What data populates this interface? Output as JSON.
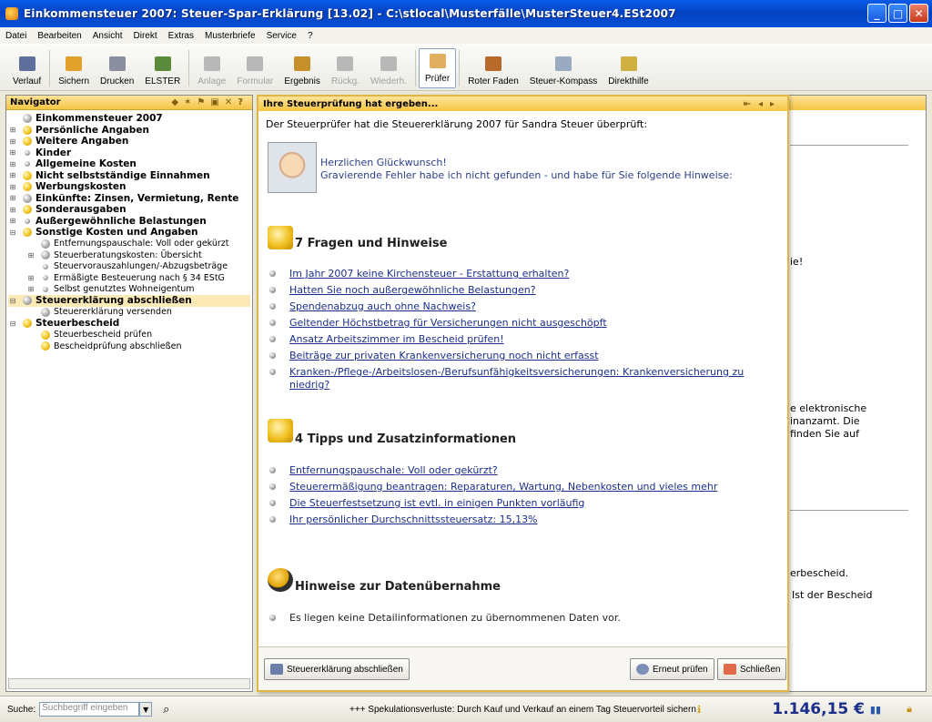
{
  "window": {
    "title": "Einkommensteuer 2007: Steuer-Spar-Erklärung [13.02] - C:\\stlocal\\Musterfälle\\MusterSteuer4.ESt2007"
  },
  "menu": [
    "Datei",
    "Bearbeiten",
    "Ansicht",
    "Direkt",
    "Extras",
    "Musterbriefe",
    "Service",
    "?"
  ],
  "toolbar": [
    {
      "label": "Verlauf",
      "state": "normal",
      "color": "#5d6f9a"
    },
    {
      "label": "Sichern",
      "state": "normal",
      "color": "#e2a12a"
    },
    {
      "label": "Drucken",
      "state": "normal",
      "color": "#8a8fa0"
    },
    {
      "label": "ELSTER",
      "state": "normal",
      "color": "#5a8a3a"
    },
    {
      "label": "Anlage",
      "state": "disabled",
      "color": "#b8b8b8"
    },
    {
      "label": "Formular",
      "state": "disabled",
      "color": "#b8b8b8"
    },
    {
      "label": "Ergebnis",
      "state": "normal",
      "color": "#c8902a"
    },
    {
      "label": "Rückg.",
      "state": "disabled",
      "color": "#b8b8b8"
    },
    {
      "label": "Wiederh.",
      "state": "disabled",
      "color": "#b8b8b8"
    },
    {
      "label": "Prüfer",
      "state": "active",
      "color": "#e0b060"
    },
    {
      "label": "Roter Faden",
      "state": "normal",
      "color": "#b86a2a"
    },
    {
      "label": "Steuer-Kompass",
      "state": "normal",
      "color": "#9aaac0"
    },
    {
      "label": "Direkthilfe",
      "state": "normal",
      "color": "#d0b040"
    }
  ],
  "navigator": {
    "title": "Navigator",
    "items": [
      {
        "label": "Einkommensteuer 2007",
        "level": 0,
        "bullet": "grey",
        "expander": ""
      },
      {
        "label": "Persönliche Angaben",
        "level": 0,
        "bullet": "yellow",
        "expander": "⊞"
      },
      {
        "label": "Weitere Angaben",
        "level": 0,
        "bullet": "yellow",
        "expander": "⊞"
      },
      {
        "label": "Kinder",
        "level": 0,
        "bullet": "small",
        "expander": "⊞"
      },
      {
        "label": "Allgemeine Kosten",
        "level": 0,
        "bullet": "small",
        "expander": "⊞"
      },
      {
        "label": "Nicht selbstständige Einnahmen",
        "level": 0,
        "bullet": "yellow",
        "expander": "⊞"
      },
      {
        "label": "Werbungskosten",
        "level": 0,
        "bullet": "yellow",
        "expander": "⊞"
      },
      {
        "label": "Einkünfte: Zinsen, Vermietung, Rente",
        "level": 0,
        "bullet": "grey",
        "expander": "⊞"
      },
      {
        "label": "Sonderausgaben",
        "level": 0,
        "bullet": "yellow",
        "expander": "⊞"
      },
      {
        "label": "Außergewöhnliche Belastungen",
        "level": 0,
        "bullet": "small",
        "expander": "⊞"
      },
      {
        "label": "Sonstige Kosten und Angaben",
        "level": 0,
        "bullet": "yellow",
        "expander": "⊟"
      },
      {
        "label": "Entfernungspauschale: Voll oder gekürzt",
        "level": 1,
        "bullet": "grey",
        "expander": ""
      },
      {
        "label": "Steuerberatungskosten: Übersicht",
        "level": 1,
        "bullet": "grey",
        "expander": "⊞"
      },
      {
        "label": "Steuervorauszahlungen/-Abzugsbeträge",
        "level": 1,
        "bullet": "small",
        "expander": ""
      },
      {
        "label": "Ermäßigte Besteuerung nach § 34 EStG",
        "level": 1,
        "bullet": "small",
        "expander": "⊞"
      },
      {
        "label": "Selbst genutztes Wohneigentum",
        "level": 1,
        "bullet": "small",
        "expander": "⊞"
      },
      {
        "label": "Steuererklärung abschließen",
        "level": 0,
        "bullet": "grey",
        "expander": "⊟",
        "selected": true
      },
      {
        "label": "Steuererklärung versenden",
        "level": 1,
        "bullet": "grey",
        "expander": ""
      },
      {
        "label": "Steuerbescheid",
        "level": 0,
        "bullet": "yellow",
        "expander": "⊟"
      },
      {
        "label": "Steuerbescheid prüfen",
        "level": 1,
        "bullet": "yellow",
        "expander": ""
      },
      {
        "label": "Bescheidprüfung abschließen",
        "level": 1,
        "bullet": "yellow",
        "expander": ""
      }
    ]
  },
  "background": {
    "fragments": [
      "ie!",
      "e elektronische",
      "inanzamt. Die",
      "finden Sie auf",
      "erbescheid.",
      "Ist der Bescheid"
    ]
  },
  "dialog": {
    "title": "Ihre Steuerprüfung hat ergeben...",
    "intro": "Der Steuerprüfer hat die Steuererklärung 2007 für Sandra Steuer überprüft:",
    "congrats_line1": "Herzlichen Glückwunsch!",
    "congrats_line2": "Gravierende Fehler habe ich nicht gefunden - und habe für Sie folgende Hinweise:",
    "questions_title": "7 Fragen und Hinweise",
    "questions": [
      "Im Jahr 2007 keine Kirchensteuer - Erstattung erhalten?",
      "Hatten Sie noch außergewöhnliche Belastungen?",
      "Spendenabzug auch ohne Nachweis?",
      "Geltender Höchstbetrag für Versicherungen nicht ausgeschöpft",
      "Ansatz Arbeitszimmer im Bescheid prüfen!",
      "Beiträge zur privaten Krankenversicherung noch nicht erfasst",
      "Kranken-/Pflege-/Arbeitslosen-/Berufsunfähigkeitsversicherungen: Krankenversicherung zu niedrig?"
    ],
    "tips_title": "4 Tipps und Zusatzinformationen",
    "tips": [
      "Entfernungspauschale: Voll oder gekürzt?",
      "Steuerermäßigung beantragen: Reparaturen, Wartung, Nebenkosten und vieles mehr",
      "Die Steuerfestsetzung ist evtl. in einigen Punkten vorläufig",
      "Ihr persönlicher Durchschnittssteuersatz: 15,13%"
    ],
    "data_title": "Hinweise zur Datenübernahme",
    "data_note": "Es liegen keine Detailinformationen zu übernommenen Daten vor.",
    "buttons": {
      "finish": "Steuererklärung abschließen",
      "recheck": "Erneut prüfen",
      "close": "Schließen"
    }
  },
  "statusbar": {
    "search_label": "Suche:",
    "search_placeholder": "Suchbegriff eingeben",
    "ticker": "+++ Spekulationsverluste: Durch Kauf und Verkauf an einem Tag Steuervorteil sichern",
    "amount": "1.146,15 €"
  }
}
